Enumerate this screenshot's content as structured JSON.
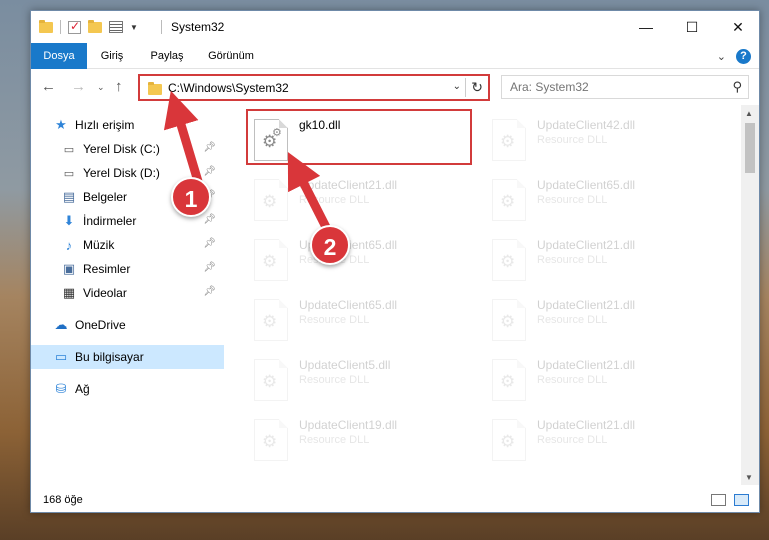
{
  "window": {
    "title": "System32",
    "controls": {
      "minimize": "—",
      "maximize": "☐",
      "close": "✕"
    }
  },
  "ribbon": {
    "tabs": [
      "Dosya",
      "Giriş",
      "Paylaş",
      "Görünüm"
    ]
  },
  "address_bar": {
    "path": "C:\\Windows\\System32",
    "icon": "folder-icon"
  },
  "search": {
    "placeholder": "Ara: System32"
  },
  "sidebar": {
    "items": [
      {
        "label": "Hızlı erişim",
        "icon": "star-icon",
        "pinned": false
      },
      {
        "label": "Yerel Disk (C:)",
        "icon": "drive-icon",
        "pinned": true
      },
      {
        "label": "Yerel Disk (D:)",
        "icon": "drive-icon",
        "pinned": true
      },
      {
        "label": "Belgeler",
        "icon": "documents-icon",
        "pinned": true
      },
      {
        "label": "İndirmeler",
        "icon": "download-icon",
        "pinned": true
      },
      {
        "label": "Müzik",
        "icon": "music-icon",
        "pinned": true
      },
      {
        "label": "Resimler",
        "icon": "pictures-icon",
        "pinned": true
      },
      {
        "label": "Videolar",
        "icon": "videos-icon",
        "pinned": true
      },
      {
        "label": "OneDrive",
        "icon": "cloud-icon",
        "pinned": false
      },
      {
        "label": "Bu bilgisayar",
        "icon": "computer-icon",
        "pinned": false,
        "selected": true
      },
      {
        "label": "Ağ",
        "icon": "network-icon",
        "pinned": false
      }
    ]
  },
  "files": [
    {
      "name": "gk10.dll",
      "type": ""
    },
    {
      "name": "UpdateClient42.dll",
      "type": "Resource DLL"
    },
    {
      "name": "UpdateClient21.dll",
      "type": "Resource DLL"
    },
    {
      "name": "UpdateClient65.dll",
      "type": "Resource DLL"
    },
    {
      "name": "UpdateClient65.dll",
      "type": "Resource DLL"
    },
    {
      "name": "UpdateClient21.dll",
      "type": "Resource DLL"
    },
    {
      "name": "UpdateClient65.dll",
      "type": "Resource DLL"
    },
    {
      "name": "UpdateClient21.dll",
      "type": "Resource DLL"
    },
    {
      "name": "UpdateClient5.dll",
      "type": "Resource DLL"
    },
    {
      "name": "UpdateClient21.dll",
      "type": "Resource DLL"
    },
    {
      "name": "UpdateClient19.dll",
      "type": "Resource DLL"
    },
    {
      "name": "UpdateClient21.dll",
      "type": "Resource DLL"
    }
  ],
  "status": {
    "item_count": "168 öğe"
  },
  "annotations": {
    "callouts": [
      "1",
      "2"
    ],
    "color": "#d9363a"
  }
}
